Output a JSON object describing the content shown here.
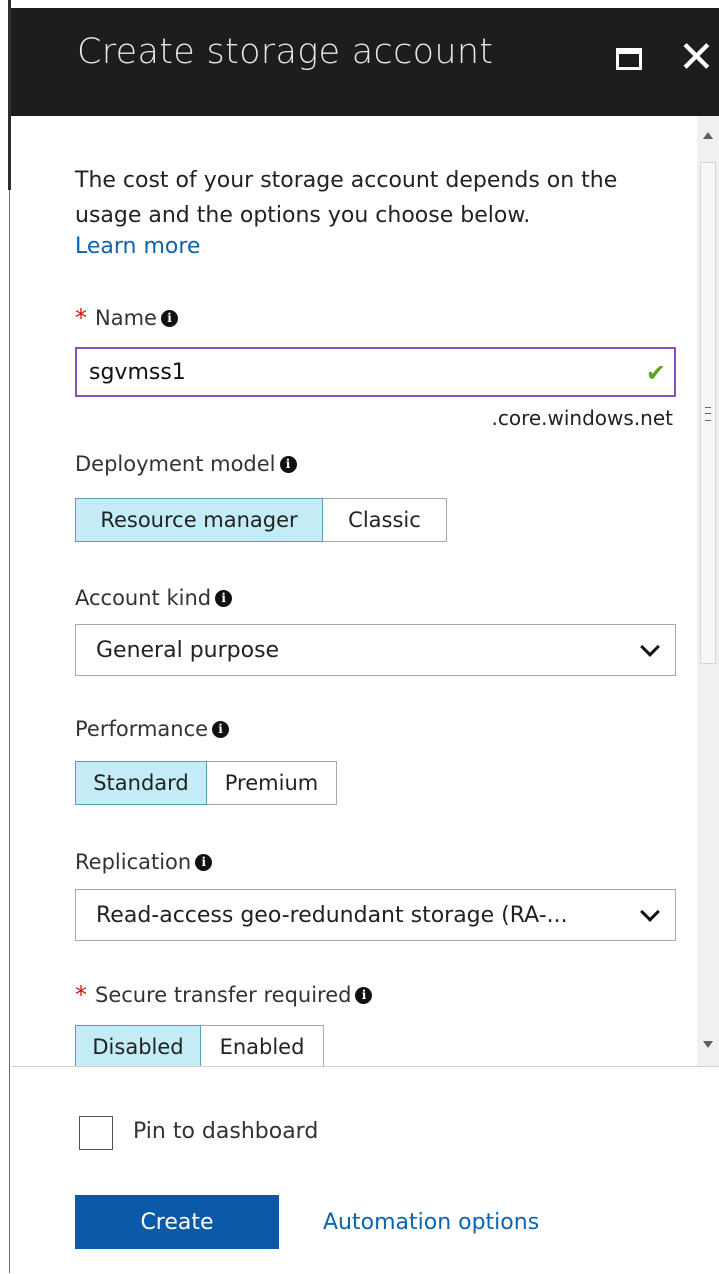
{
  "header": {
    "title": "Create storage account"
  },
  "intro": {
    "description": "The cost of your storage account depends on the usage and the options you choose below.",
    "learn_more": "Learn more"
  },
  "name_field": {
    "required_mark": "*",
    "label": "Name",
    "value": "sgvmss1",
    "suffix": ".core.windows.net",
    "valid": true
  },
  "deployment_model": {
    "label": "Deployment model",
    "options": [
      "Resource manager",
      "Classic"
    ],
    "selected": "Resource manager"
  },
  "account_kind": {
    "label": "Account kind",
    "value": "General purpose"
  },
  "performance": {
    "label": "Performance",
    "options": [
      "Standard",
      "Premium"
    ],
    "selected": "Standard"
  },
  "replication": {
    "label": "Replication",
    "value": "Read-access geo-redundant storage (RA-..."
  },
  "secure_transfer": {
    "required_mark": "*",
    "label": "Secure transfer required",
    "options": [
      "Disabled",
      "Enabled"
    ],
    "selected": "Disabled"
  },
  "footer": {
    "pin_label": "Pin to dashboard",
    "pin_checked": false,
    "create_label": "Create",
    "automation_label": "Automation options"
  },
  "colors": {
    "header_bg": "#1d1d1d",
    "selected_option_bg": "#c3ecf7",
    "primary_button": "#0b5aa8",
    "link": "#0a64b4",
    "required": "#dd1111",
    "valid_check": "#5aa51d",
    "input_focus_border": "#8a4fb5"
  },
  "icons": {
    "maximize": "maximize-icon",
    "close": "close-icon",
    "info": "info-icon",
    "valid": "checkmark-icon",
    "dropdown": "chevron-down-icon"
  }
}
